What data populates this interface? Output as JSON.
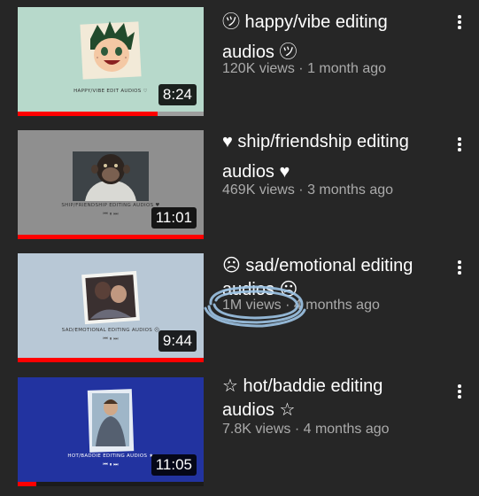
{
  "videos": [
    {
      "title_line1": "㋡ happy/vibe editing",
      "title_line2": "audios ㋡",
      "views": "120K views",
      "separator": "·",
      "age": "1 month ago",
      "duration": "8:24",
      "watched": 0.75,
      "thumb_bg": "#b7d9cb",
      "caption": "HAPPY/VIBE EDIT AUDIOS ♡"
    },
    {
      "title_line1": "♥ ship/friendship editing",
      "title_line2": "audios ♥",
      "views": "469K views",
      "separator": "·",
      "age": "3 months ago",
      "duration": "11:01",
      "watched": 1.0,
      "thumb_bg": "#8f8f8f",
      "caption": "SHIP/FRIENDSHIP EDITING AUDIOS ♥"
    },
    {
      "title_line1": "☹ sad/emotional editing",
      "title_line2": "audios ☹",
      "views": "1M views",
      "separator": "·",
      "age": "4 months ago",
      "duration": "9:44",
      "watched": 1.0,
      "thumb_bg": "#b8c8d6",
      "caption": "SAD/EMOTIONAL EDITING AUDIOS ☹"
    },
    {
      "title_line1": "☆ hot/baddie editing",
      "title_line2": "audios ☆",
      "views": "7.8K views",
      "separator": "·",
      "age": "4 months ago",
      "duration": "11:05",
      "watched": 0.1,
      "thumb_bg": "#2233a0",
      "caption": "HOT/BADDIE EDITING AUDIOS ★"
    }
  ],
  "player_controls": "⏮ ⏸ ⏭",
  "colors": {
    "background": "#262626",
    "progress": "#ff0000",
    "meta_text": "#aaaaaa",
    "annotation": "#9ec5e6"
  },
  "icons": [
    "more-vert-icon"
  ]
}
